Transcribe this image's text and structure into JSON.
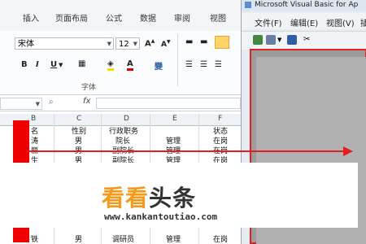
{
  "excel": {
    "tabs": [
      "插入",
      "页面布局",
      "公式",
      "数据",
      "审阅",
      "视图"
    ],
    "font_name": "宋体",
    "font_size": "12",
    "font_group_label": "字体",
    "bold": "B",
    "italic": "I",
    "underline": "U",
    "cell_ref": "",
    "fx": "fx",
    "columns": [
      "B",
      "C",
      "D",
      "E",
      "F"
    ],
    "rows": [
      [
        "名",
        "性别",
        "行政职务",
        "",
        "状态"
      ],
      [
        "涛",
        "男",
        "院长",
        "管理",
        "在岗"
      ],
      [
        "丽",
        "男",
        "副院长",
        "管理",
        "在岗"
      ],
      [
        "生",
        "男",
        "副院长",
        "管理",
        "在岗"
      ]
    ],
    "bottom_row": [
      "铁",
      "男",
      "调研员",
      "管理",
      "在岗"
    ]
  },
  "vba": {
    "title": "Microsoft Visual Basic for Ap",
    "menu": [
      "文件(F)",
      "编辑(E)",
      "视图(V)",
      "插"
    ]
  },
  "watermark": {
    "logo_orange": "看看",
    "logo_dark": "头条",
    "site": "www.kankantoutiao.com"
  },
  "colors": {
    "accent_red": "#e02020",
    "logo_orange": "#f39a1c"
  }
}
